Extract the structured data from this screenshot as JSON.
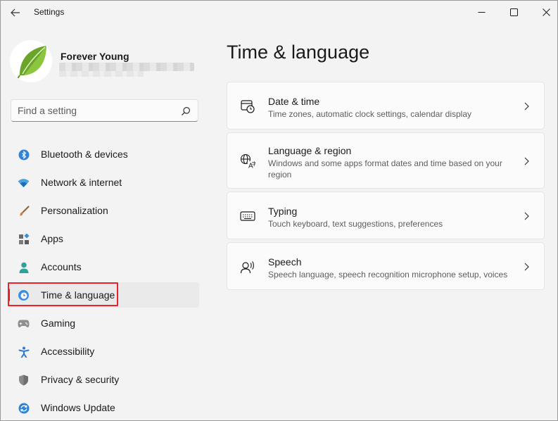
{
  "window": {
    "title": "Settings",
    "controls": [
      "minimize",
      "maximize",
      "close"
    ]
  },
  "user": {
    "name": "Forever Young"
  },
  "search": {
    "placeholder": "Find a setting",
    "value": ""
  },
  "sidebar": {
    "items": [
      {
        "label": "Bluetooth & devices",
        "icon": "bluetooth-icon"
      },
      {
        "label": "Network & internet",
        "icon": "wifi-icon"
      },
      {
        "label": "Personalization",
        "icon": "brush-icon"
      },
      {
        "label": "Apps",
        "icon": "apps-icon"
      },
      {
        "label": "Accounts",
        "icon": "person-icon"
      },
      {
        "label": "Time & language",
        "icon": "globe-clock-icon",
        "selected": true
      },
      {
        "label": "Gaming",
        "icon": "gamepad-icon"
      },
      {
        "label": "Accessibility",
        "icon": "accessibility-icon"
      },
      {
        "label": "Privacy & security",
        "icon": "shield-icon"
      },
      {
        "label": "Windows Update",
        "icon": "update-icon"
      }
    ]
  },
  "main": {
    "title": "Time & language",
    "cards": [
      {
        "title": "Date & time",
        "desc": "Time zones, automatic clock settings, calendar display",
        "icon": "calendar-clock-icon"
      },
      {
        "title": "Language & region",
        "desc": "Windows and some apps format dates and time based on your region",
        "icon": "language-icon"
      },
      {
        "title": "Typing",
        "desc": "Touch keyboard, text suggestions, preferences",
        "icon": "keyboard-icon"
      },
      {
        "title": "Speech",
        "desc": "Speech language, speech recognition microphone setup, voices",
        "icon": "speech-icon"
      }
    ]
  },
  "colors": {
    "accent": "#0067c0",
    "highlight": "#e8232b",
    "background": "#f3f3f3",
    "card": "#fbfbfb"
  }
}
